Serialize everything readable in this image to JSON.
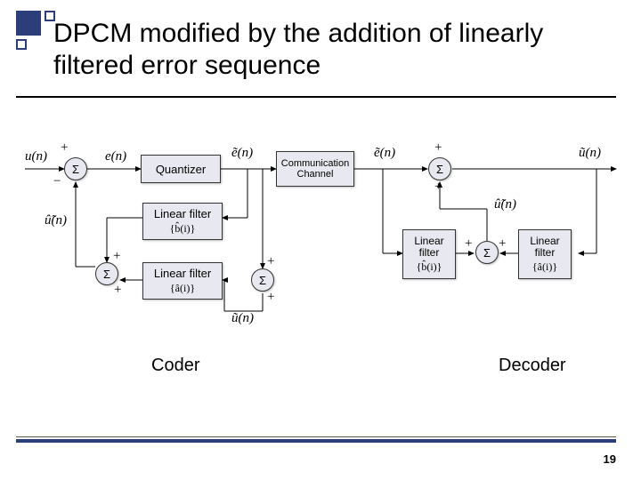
{
  "title": "DPCM modified by the addition of linearly filtered error sequence",
  "page_number": "19",
  "labels": {
    "coder": "Coder",
    "decoder": "Decoder"
  },
  "blocks": {
    "quantizer": "Quantizer",
    "channel_line1": "Communication",
    "channel_line2": "Channel",
    "linfilt": "Linear filter",
    "linfilt_line1": "Linear",
    "linfilt_line2": "filter",
    "coeff_b": "{b̂(i)}",
    "coeff_a": "{â(i)}"
  },
  "sum": "Σ",
  "signs": {
    "plus": "+",
    "minus": "−"
  },
  "signals": {
    "u_n": "u(n)",
    "e_n": "e(n)",
    "etil_n": "ẽ(n)",
    "etil_n2": "ẽ(n)",
    "util_n": "ũ(n)",
    "uhat_n": "û̃(n)",
    "uhat_n2": "û̃(n)",
    "utilhat_n": "ũ(n)"
  }
}
